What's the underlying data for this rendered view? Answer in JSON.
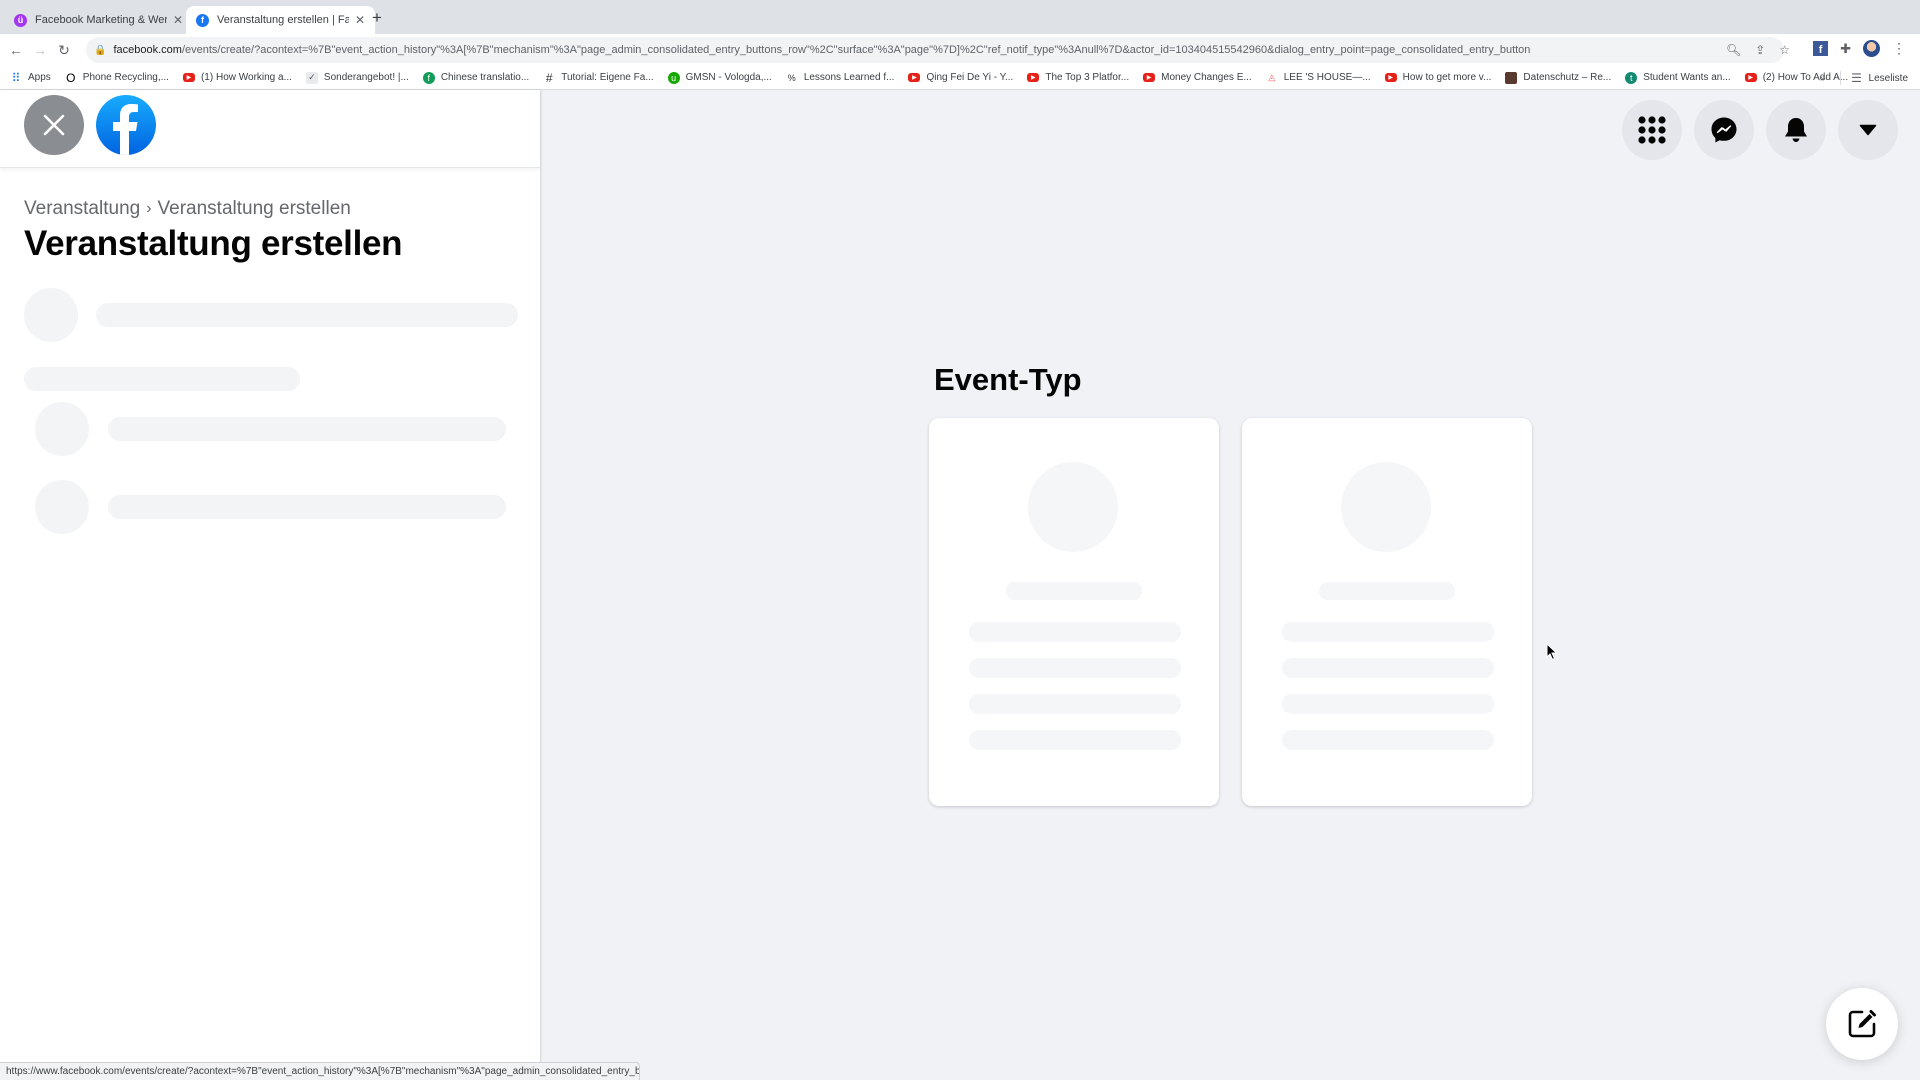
{
  "browser": {
    "tabs": [
      {
        "title": "Facebook Marketing & Werbea",
        "favicon": "udemy-icon",
        "active": false
      },
      {
        "title": "Veranstaltung erstellen | Faceb",
        "favicon": "facebook-icon",
        "active": true
      }
    ],
    "url": {
      "host": "facebook.com",
      "path": "/events/create/?acontext=%7B\"event_action_history\"%3A[%7B\"mechanism\"%3A\"page_admin_consolidated_entry_buttons_row\"%2C\"surface\"%3A\"page\"%7D]%2C\"ref_notif_type\"%3Anull%7D&actor_id=103404515542960&dialog_entry_point=page_consolidated_entry_button"
    },
    "bookmarks": [
      {
        "label": "Apps",
        "icon": "apps-grid-icon"
      },
      {
        "label": "Phone Recycling,...",
        "icon": "o2-icon"
      },
      {
        "label": "(1) How Working a...",
        "icon": "youtube-icon"
      },
      {
        "label": "Sonderangebot! |...",
        "icon": "check-badge-icon"
      },
      {
        "label": "Chinese translatio...",
        "icon": "green-circle-icon"
      },
      {
        "label": "Tutorial: Eigene Fa...",
        "icon": "hashtag-icon"
      },
      {
        "label": "GMSN - Vologda,...",
        "icon": "upwork-icon"
      },
      {
        "label": "Lessons Learned f...",
        "icon": "percent-icon"
      },
      {
        "label": "Qing Fei De Yi - Y...",
        "icon": "youtube-icon"
      },
      {
        "label": "The Top 3 Platfor...",
        "icon": "youtube-icon"
      },
      {
        "label": "Money Changes E...",
        "icon": "youtube-icon"
      },
      {
        "label": "LEE 'S HOUSE—...",
        "icon": "airbnb-icon"
      },
      {
        "label": "How to get more v...",
        "icon": "youtube-icon"
      },
      {
        "label": "Datenschutz – Re...",
        "icon": "image-thumb-icon"
      },
      {
        "label": "Student Wants an...",
        "icon": "teal-circle-icon"
      },
      {
        "label": "(2) How To Add A...",
        "icon": "youtube-icon"
      }
    ],
    "more_label": "»",
    "reading_list": "Leseliste",
    "status_url": "https://www.facebook.com/events/create/?acontext=%7B\"event_action_history\"%3A[%7B\"mechanism\"%3A\"page_admin_consolidated_entry_butto..."
  },
  "sidebar": {
    "breadcrumb": [
      "Veranstaltung",
      "Veranstaltung erstellen"
    ],
    "breadcrumb_sep": "›",
    "title": "Veranstaltung erstellen"
  },
  "main": {
    "section_title": "Event-Typ",
    "cards_loading": 2
  },
  "colors": {
    "facebook_blue": "#1877f2",
    "page_bg": "#f0f2f5",
    "close_gray": "#8a8d91"
  }
}
